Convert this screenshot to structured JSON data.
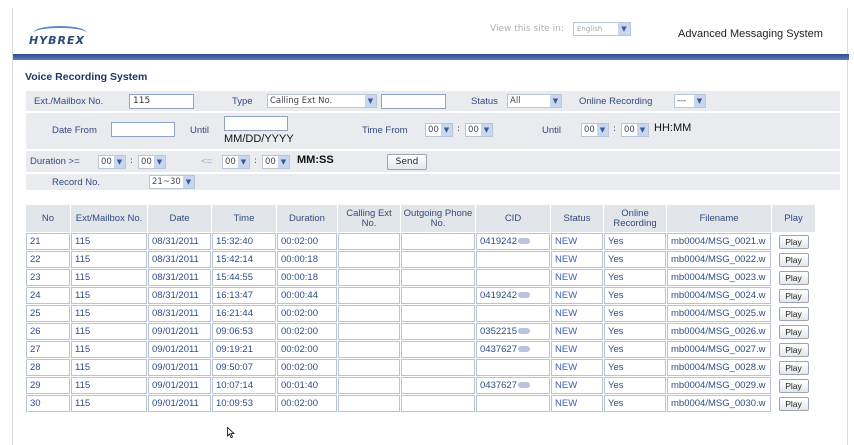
{
  "header": {
    "logo": "HYBREX",
    "view_site_label": "View this site in:",
    "language": "English",
    "app_title": "Advanced Messaging System"
  },
  "page": {
    "title": "Voice Recording System"
  },
  "filters": {
    "ext_label": "Ext./Mailbox No.",
    "ext_value": "115",
    "type_label": "Type",
    "type_value": "Calling Ext No.",
    "type_text": "",
    "status_label": "Status",
    "status_value": "All",
    "online_label": "Online Recording",
    "online_value": "---",
    "date_from_label": "Date From",
    "date_from_value": "",
    "until_label": "Until",
    "until_value": "",
    "date_format": "MM/DD/YYYY",
    "time_from_label": "Time From",
    "time_from_hh": "00",
    "time_from_mm": "00",
    "time_until_label": "Until",
    "time_until_hh": "00",
    "time_until_mm": "00",
    "time_format": "HH:MM",
    "duration_ge_label": "Duration >=",
    "dur_ge_mm": "00",
    "dur_ge_ss": "00",
    "duration_le_label": "<=",
    "dur_le_mm": "00",
    "dur_le_ss": "00",
    "duration_format": "MM:SS",
    "send_label": "Send",
    "record_label": "Record No.",
    "record_value": "21~30",
    "colon": ":"
  },
  "table": {
    "headers": [
      "No",
      "Ext/Mailbox No.",
      "Date",
      "Time",
      "Duration",
      "Calling Ext No.",
      "Outgoing Phone No.",
      "CID",
      "Status",
      "Online Recording",
      "Filename",
      "Play"
    ],
    "play_label": "Play",
    "rows": [
      {
        "no": "21",
        "ext": "115",
        "date": "08/31/2011",
        "time": "15:32:40",
        "duration": "00:02:00",
        "calling": "",
        "outgoing": "",
        "cid": "0419242",
        "status": "NEW",
        "online": "Yes",
        "filename": "mb0004/MSG_0021.w"
      },
      {
        "no": "22",
        "ext": "115",
        "date": "08/31/2011",
        "time": "15:42:14",
        "duration": "00:00:18",
        "calling": "",
        "outgoing": "",
        "cid": "",
        "status": "NEW",
        "online": "Yes",
        "filename": "mb0004/MSG_0022.w"
      },
      {
        "no": "23",
        "ext": "115",
        "date": "08/31/2011",
        "time": "15:44:55",
        "duration": "00:00:18",
        "calling": "",
        "outgoing": "",
        "cid": "",
        "status": "NEW",
        "online": "Yes",
        "filename": "mb0004/MSG_0023.w"
      },
      {
        "no": "24",
        "ext": "115",
        "date": "08/31/2011",
        "time": "16:13:47",
        "duration": "00:00:44",
        "calling": "",
        "outgoing": "",
        "cid": "0419242",
        "status": "NEW",
        "online": "Yes",
        "filename": "mb0004/MSG_0024.w"
      },
      {
        "no": "25",
        "ext": "115",
        "date": "08/31/2011",
        "time": "16:21:44",
        "duration": "00:02:00",
        "calling": "",
        "outgoing": "",
        "cid": "",
        "status": "NEW",
        "online": "Yes",
        "filename": "mb0004/MSG_0025.w"
      },
      {
        "no": "26",
        "ext": "115",
        "date": "09/01/2011",
        "time": "09:06:53",
        "duration": "00:02:00",
        "calling": "",
        "outgoing": "",
        "cid": "0352215",
        "status": "NEW",
        "online": "Yes",
        "filename": "mb0004/MSG_0026.w"
      },
      {
        "no": "27",
        "ext": "115",
        "date": "09/01/2011",
        "time": "09:19:21",
        "duration": "00:02:00",
        "calling": "",
        "outgoing": "",
        "cid": "0437627",
        "status": "NEW",
        "online": "Yes",
        "filename": "mb0004/MSG_0027.w"
      },
      {
        "no": "28",
        "ext": "115",
        "date": "09/01/2011",
        "time": "09:50:07",
        "duration": "00:02:00",
        "calling": "",
        "outgoing": "",
        "cid": "",
        "status": "NEW",
        "online": "Yes",
        "filename": "mb0004/MSG_0028.w"
      },
      {
        "no": "29",
        "ext": "115",
        "date": "09/01/2011",
        "time": "10:07:14",
        "duration": "00:01:40",
        "calling": "",
        "outgoing": "",
        "cid": "0437627",
        "status": "NEW",
        "online": "Yes",
        "filename": "mb0004/MSG_0029.w"
      },
      {
        "no": "30",
        "ext": "115",
        "date": "09/01/2011",
        "time": "10:09:53",
        "duration": "00:02:00",
        "calling": "",
        "outgoing": "",
        "cid": "",
        "status": "NEW",
        "online": "Yes",
        "filename": "mb0004/MSG_0030.w"
      }
    ]
  },
  "colors": {
    "accent_bar": "#2f4a8c",
    "label_text": "#324a7c",
    "cell_text": "#2d4d86",
    "header_bg": "#e2e5ea"
  },
  "icons": {
    "dropdown": "chevron-down-icon",
    "cursor": "pointer-cursor-icon"
  }
}
